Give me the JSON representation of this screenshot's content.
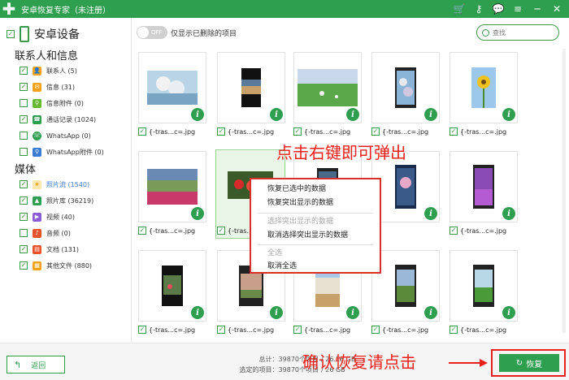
{
  "app": {
    "title": "安卓恢复专家（未注册）",
    "toolbar_icons": [
      "cart-icon",
      "key-icon",
      "chat-icon",
      "menu-icon",
      "minimize-icon",
      "close-icon"
    ]
  },
  "sidebar": {
    "device": "安卓设备",
    "section1": "联系人和信息",
    "section2": "媒体",
    "items": [
      {
        "label": "联系人 (5)",
        "icon": "contacts-icon",
        "color": "#f2a31b"
      },
      {
        "label": "信息 (31)",
        "icon": "message-icon",
        "color": "#f2a31b"
      },
      {
        "label": "信息附件 (0)",
        "icon": "attachment-icon",
        "color": "#65b92e"
      },
      {
        "label": "通话记录 (1024)",
        "icon": "call-log-icon",
        "color": "#2e9e4f"
      },
      {
        "label": "WhatsApp (0)",
        "icon": "whatsapp-icon",
        "color": "#2e9e4f"
      },
      {
        "label": "WhatsApp附件 (0)",
        "icon": "whatsapp-attachment-icon",
        "color": "#3a7bd5"
      },
      {
        "label": "照片流 (1540)",
        "icon": "photo-stream-icon",
        "color": "#f2a31b"
      },
      {
        "label": "照片库 (36219)",
        "icon": "photo-library-icon",
        "color": "#2e9e4f"
      },
      {
        "label": "视频 (40)",
        "icon": "video-icon",
        "color": "#8b5cd6"
      },
      {
        "label": "音频 (0)",
        "icon": "audio-icon",
        "color": "#e8532c"
      },
      {
        "label": "文档 (131)",
        "icon": "document-icon",
        "color": "#e8532c"
      },
      {
        "label": "其他文件 (880)",
        "icon": "other-files-icon",
        "color": "#f2a31b"
      }
    ]
  },
  "filter": {
    "toggle_label": "OFF",
    "text": "仅显示已删除的项目",
    "search_placeholder": "查找"
  },
  "file_caption": "{-tras...c=.jpg",
  "context_menu": {
    "items": [
      "恢复已选中的数据",
      "恢复突出显示的数据",
      "选择突出显示的数据",
      "取消选择突出显示的数据",
      "全选",
      "取消全选"
    ]
  },
  "callouts": {
    "right_click": "点击右键即可弹出",
    "confirm": "确认恢复请点击"
  },
  "footer": {
    "back": "返回",
    "total_label": "总计：39870个项目",
    "selected_label": "选定的项目：39870个项目",
    "total_size": "/ 26.18 GB",
    "selected_size": "/ 26 GB",
    "recover": "恢复"
  },
  "colors": {
    "brand": "#2e9e4f",
    "annotation": "#e8201c"
  }
}
